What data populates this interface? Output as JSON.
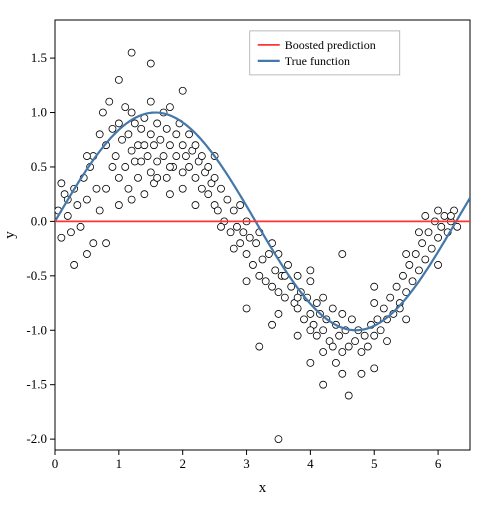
{
  "chart": {
    "title": "",
    "x_label": "x",
    "y_label": "y",
    "legend": {
      "boosted_label": "Boosted prediction",
      "true_label": "True function",
      "boosted_color": "#FF0000",
      "true_color": "#4477AA"
    },
    "x_axis": {
      "min": 0,
      "max": 6.3,
      "ticks": [
        0,
        1,
        2,
        3,
        4,
        5,
        6
      ]
    },
    "y_axis": {
      "min": -2.0,
      "max": 1.8,
      "ticks": [
        -2.0,
        -1.5,
        -1.0,
        -0.5,
        0.0,
        0.5,
        1.0,
        1.5
      ]
    }
  }
}
